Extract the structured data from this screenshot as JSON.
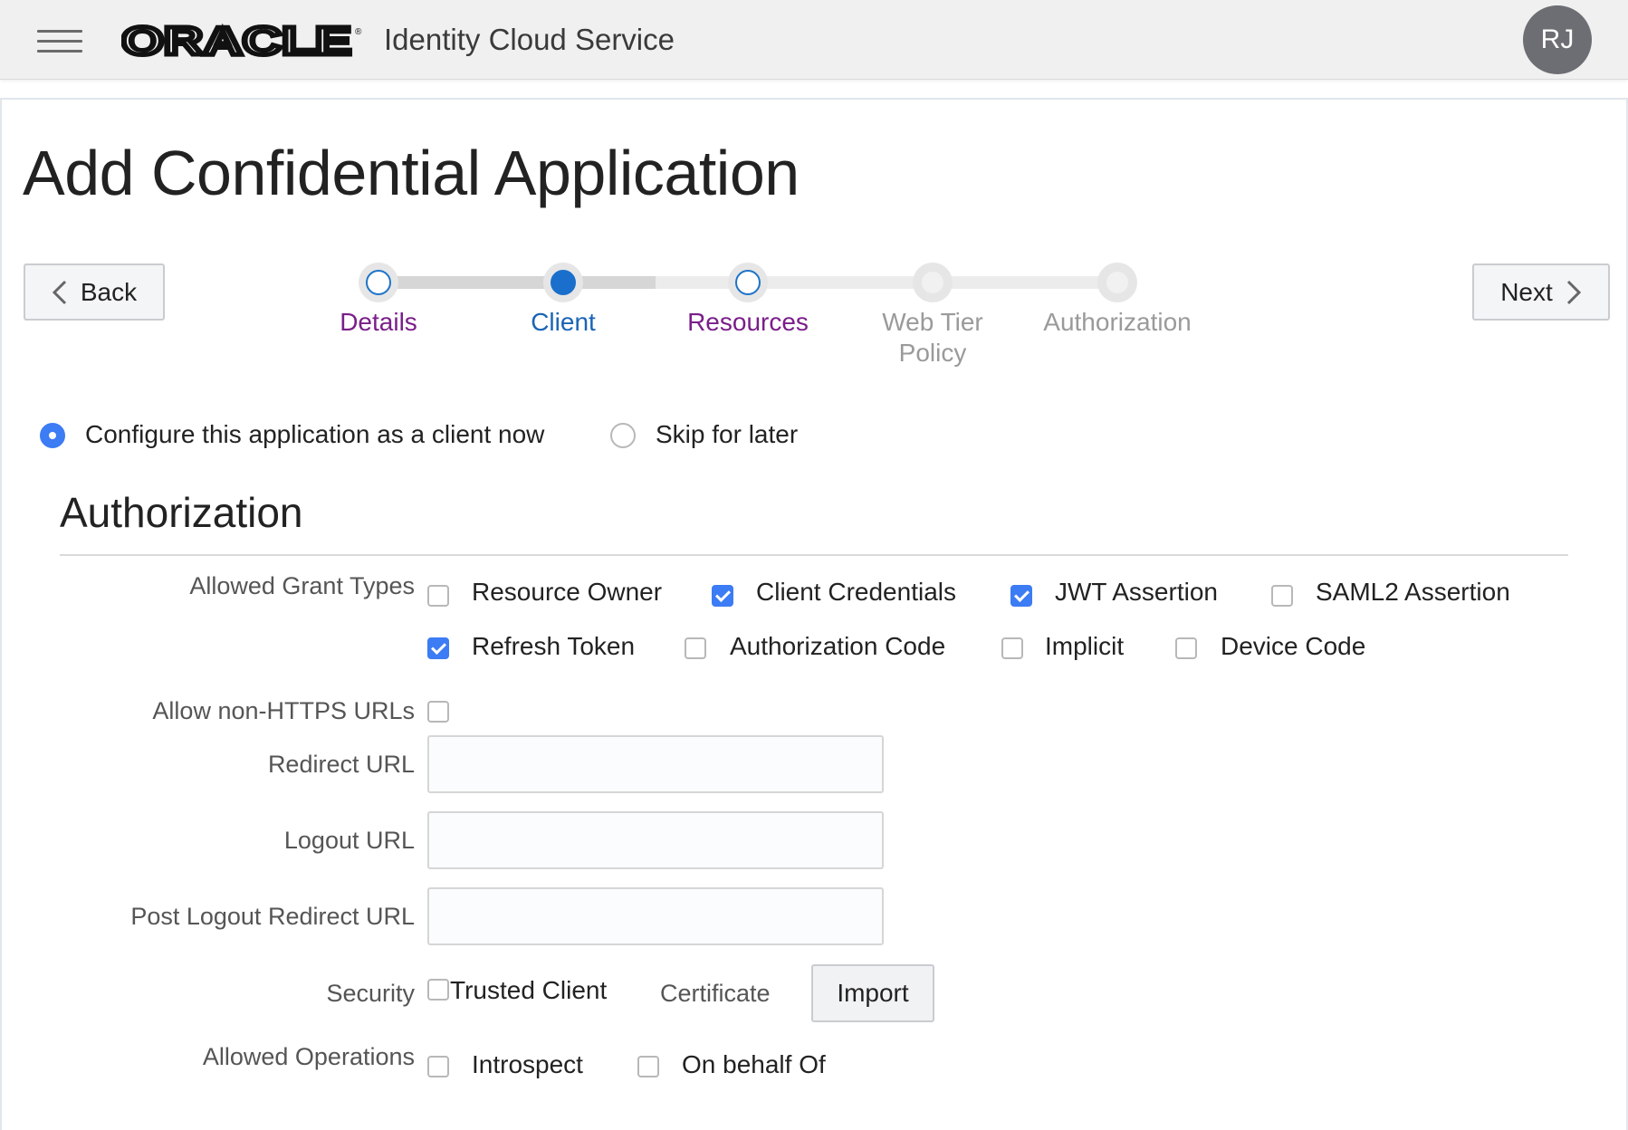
{
  "header": {
    "brand": "ORACLE",
    "app_name": "Identity Cloud Service",
    "avatar_initials": "RJ",
    "icons": {
      "menu": "hamburger-menu-icon",
      "logo": "oracle-logo"
    }
  },
  "page": {
    "title": "Add Confidential Application",
    "back_label": "Back",
    "next_label": "Next"
  },
  "train": {
    "steps": [
      {
        "label": "Details",
        "state": "visited"
      },
      {
        "label": "Client",
        "state": "current"
      },
      {
        "label": "Resources",
        "state": "visited"
      },
      {
        "label": "Web Tier Policy",
        "label_line1": "Web Tier",
        "label_line2": "Policy",
        "state": "disabled"
      },
      {
        "label": "Authorization",
        "state": "disabled"
      }
    ]
  },
  "client_mode": {
    "options": [
      {
        "label": "Configure this application as a client now",
        "checked": true
      },
      {
        "label": "Skip for later",
        "checked": false
      }
    ]
  },
  "authorization": {
    "section_title": "Authorization",
    "grant_types_label": "Allowed Grant Types",
    "grant_types": [
      {
        "label": "Resource Owner",
        "checked": false
      },
      {
        "label": "Client Credentials",
        "checked": true
      },
      {
        "label": "JWT Assertion",
        "checked": true
      },
      {
        "label": "SAML2 Assertion",
        "checked": false
      },
      {
        "label": "Refresh Token",
        "checked": true
      },
      {
        "label": "Authorization Code",
        "checked": false
      },
      {
        "label": "Implicit",
        "checked": false
      },
      {
        "label": "Device Code",
        "checked": false
      }
    ],
    "non_https_label": "Allow non-HTTPS URLs",
    "non_https_checked": false,
    "redirect_url_label": "Redirect URL",
    "redirect_url_value": "",
    "logout_url_label": "Logout URL",
    "logout_url_value": "",
    "post_logout_label": "Post Logout Redirect URL",
    "post_logout_value": "",
    "security_label": "Security",
    "trusted_client_label": "Trusted Client",
    "trusted_client_checked": false,
    "certificate_label": "Certificate",
    "import_label": "Import",
    "allowed_ops_label": "Allowed Operations",
    "allowed_ops": [
      {
        "label": "Introspect",
        "checked": false
      },
      {
        "label": "On behalf Of",
        "checked": false
      }
    ]
  },
  "colors": {
    "accent": "#3c7cf4",
    "train_current": "#1a6fcc",
    "train_visited_text": "#7a1e8a",
    "header_bg": "#f0f0f0",
    "avatar_bg": "#6d6e73"
  }
}
